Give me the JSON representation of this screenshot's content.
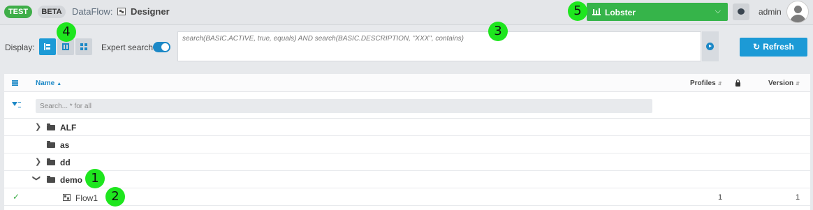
{
  "header": {
    "badge_test": "TEST",
    "badge_beta": "BETA",
    "app_name": "DataFlow:",
    "page_title": "Designer",
    "project": "Lobster",
    "username": "admin",
    "accent_color": "#36b44a"
  },
  "toolbar": {
    "display_label": "Display:",
    "view_modes": [
      "tree",
      "split",
      "grid"
    ],
    "active_view": "tree",
    "expert_search_label": "Expert search",
    "expert_search_on": true,
    "query": "search(BASIC.ACTIVE, true, equals) AND search(BASIC.DESCRIPTION, \"XXX\", contains)",
    "refresh_label": "Refresh"
  },
  "table": {
    "columns": {
      "name": "Name",
      "profiles": "Profiles",
      "version": "Version"
    },
    "filter_placeholder": "Search... * for all",
    "rows": [
      {
        "type": "folder",
        "name": "ALF",
        "expanded": false
      },
      {
        "type": "folder",
        "name": "as"
      },
      {
        "type": "folder",
        "name": "dd",
        "expanded": false
      },
      {
        "type": "folder",
        "name": "demo",
        "expanded": true
      },
      {
        "type": "flow",
        "name": "Flow1",
        "profiles": "1",
        "version": "1",
        "active": true
      }
    ]
  },
  "annotations": [
    "1",
    "2",
    "3",
    "4",
    "5"
  ]
}
